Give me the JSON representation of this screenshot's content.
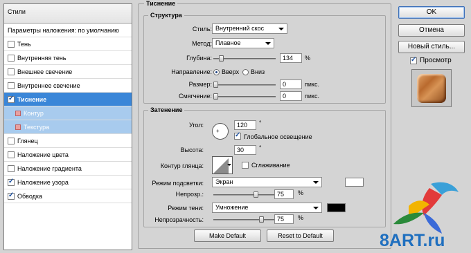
{
  "left": {
    "header": "Стили",
    "rows": [
      {
        "label": "Параметры наложения: по умолчанию",
        "checkbox": false,
        "checked": false,
        "kind": "plain"
      },
      {
        "label": "Тень",
        "checkbox": true,
        "checked": false,
        "kind": "plain"
      },
      {
        "label": "Внутренняя тень",
        "checkbox": true,
        "checked": false,
        "kind": "plain"
      },
      {
        "label": "Внешнее свечение",
        "checkbox": true,
        "checked": false,
        "kind": "plain"
      },
      {
        "label": "Внутреннее свечение",
        "checkbox": true,
        "checked": false,
        "kind": "plain"
      },
      {
        "label": "Тиснение",
        "checkbox": true,
        "checked": true,
        "kind": "active"
      },
      {
        "label": "Контур",
        "checkbox": false,
        "checked": false,
        "kind": "sub"
      },
      {
        "label": "Текстура",
        "checkbox": false,
        "checked": false,
        "kind": "sub"
      },
      {
        "label": "Глянец",
        "checkbox": true,
        "checked": false,
        "kind": "plain"
      },
      {
        "label": "Наложение цвета",
        "checkbox": true,
        "checked": false,
        "kind": "plain"
      },
      {
        "label": "Наложение градиента",
        "checkbox": true,
        "checked": false,
        "kind": "plain"
      },
      {
        "label": "Наложение узора",
        "checkbox": true,
        "checked": true,
        "kind": "plain"
      },
      {
        "label": "Обводка",
        "checkbox": true,
        "checked": true,
        "kind": "plain"
      }
    ]
  },
  "bevel": {
    "title": "Тиснение",
    "structure": {
      "title": "Структура",
      "style_label": "Стиль:",
      "style_value": "Внутренний скос",
      "method_label": "Метод:",
      "method_value": "Плавное",
      "depth_label": "Глубина:",
      "depth_value": "134",
      "depth_unit": "%",
      "direction_label": "Направление:",
      "dir_up": "Вверх",
      "dir_down": "Вниз",
      "size_label": "Размер:",
      "size_value": "0",
      "size_unit": "пикс.",
      "soften_label": "Смягчение:",
      "soften_value": "0",
      "soften_unit": "пикс."
    },
    "shading": {
      "title": "Затенение",
      "angle_label": "Угол:",
      "angle_value": "120",
      "angle_unit": "°",
      "global_light_label": "Глобальное освещение",
      "altitude_label": "Высота:",
      "altitude_value": "30",
      "altitude_unit": "°",
      "gloss_label": "Контур глянца:",
      "antialias_label": "Сглаживание",
      "highlight_mode_label": "Режим подсветки:",
      "highlight_mode_value": "Экран",
      "highlight_color": "#ffffff",
      "highlight_opacity_label": "Непрозр.:",
      "highlight_opacity_value": "75",
      "highlight_opacity_unit": "%",
      "shadow_mode_label": "Режим тени:",
      "shadow_mode_value": "Умножение",
      "shadow_color": "#000000",
      "shadow_opacity_label": "Непрозрачность:",
      "shadow_opacity_value": "75",
      "shadow_opacity_unit": "%"
    },
    "make_default": "Make Default",
    "reset_default": "Reset to Default"
  },
  "right": {
    "ok": "OK",
    "cancel": "Отмена",
    "new_style": "Новый стиль...",
    "preview": "Просмотр"
  },
  "watermark": "8ART.ru"
}
